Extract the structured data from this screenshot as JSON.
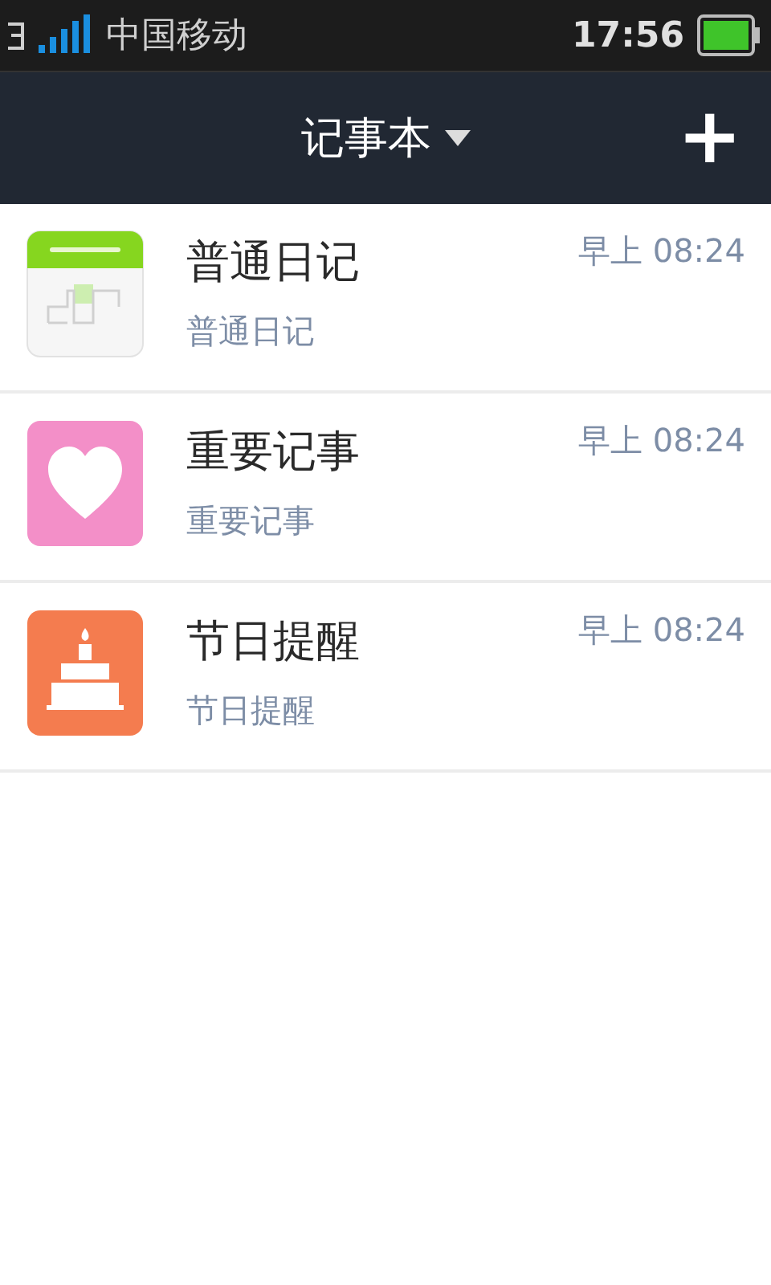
{
  "status_bar": {
    "carrier": "中国移动",
    "time": "17:56"
  },
  "toolbar": {
    "title": "记事本",
    "add_symbol": "+"
  },
  "notes": [
    {
      "kind": "diary",
      "title": "普通日记",
      "subtitle": "普通日记",
      "time": "早上 08:24"
    },
    {
      "kind": "important",
      "title": "重要记事",
      "subtitle": "重要记事",
      "time": "早上 08:24"
    },
    {
      "kind": "holiday",
      "title": "节日提醒",
      "subtitle": "节日提醒",
      "time": "早上 08:24"
    }
  ]
}
